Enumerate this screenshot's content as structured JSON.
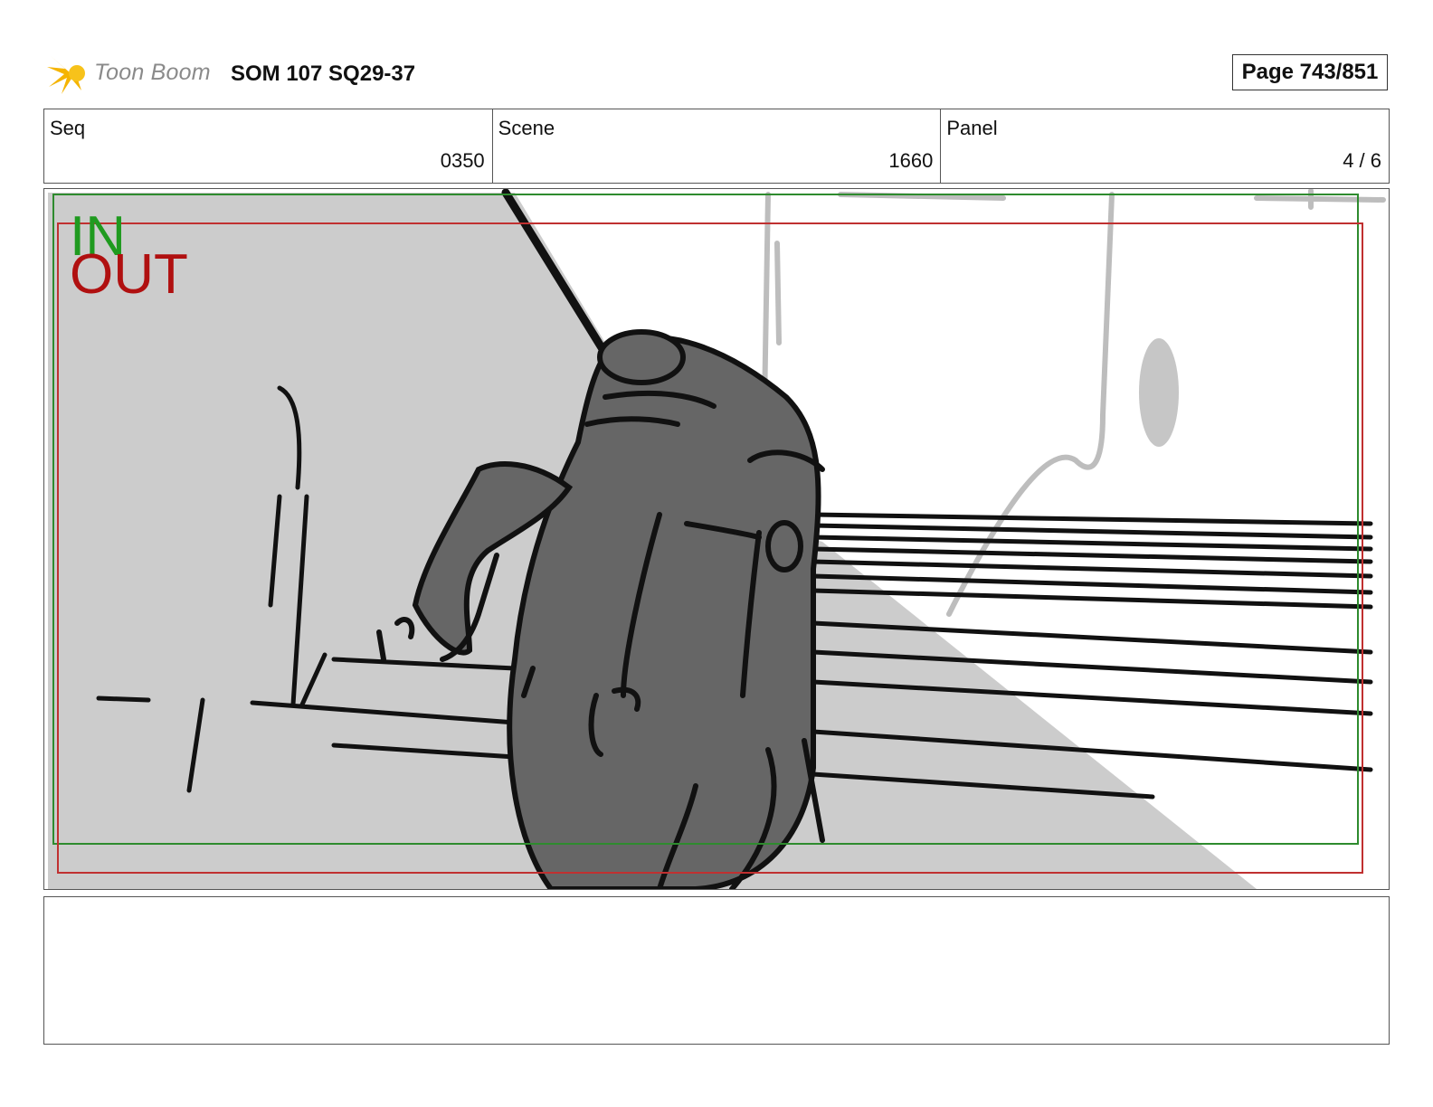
{
  "header": {
    "logo_text": "Toon Boom",
    "title": "SOM 107 SQ29-37",
    "page": "Page 743/851"
  },
  "info": {
    "seq_label": "Seq",
    "seq_value": "0350",
    "scene_label": "Scene",
    "scene_value": "1660",
    "panel_label": "Panel",
    "panel_value": "4 / 6"
  },
  "panel": {
    "in_label": "IN",
    "out_label": "OUT",
    "colors": {
      "in_frame": "#2e8b2e",
      "out_frame": "#c03030",
      "shadow": "#cccccc",
      "character": "#666666"
    }
  },
  "notes": {
    "text": ""
  }
}
